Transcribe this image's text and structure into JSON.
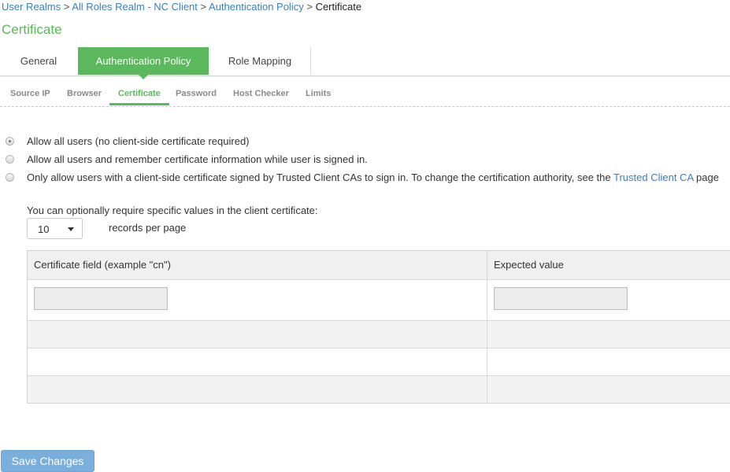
{
  "breadcrumb": {
    "items": [
      "User Realms",
      "All Roles Realm - NC Client",
      "Authentication Policy"
    ],
    "separator": ">",
    "current": "Certificate"
  },
  "page_title": "Certificate",
  "tabs": [
    {
      "label": "General",
      "active": false
    },
    {
      "label": "Authentication Policy",
      "active": true
    },
    {
      "label": "Role Mapping",
      "active": false
    }
  ],
  "subtabs": [
    {
      "label": "Source IP",
      "active": false
    },
    {
      "label": "Browser",
      "active": false
    },
    {
      "label": "Certificate",
      "active": true
    },
    {
      "label": "Password",
      "active": false
    },
    {
      "label": "Host Checker",
      "active": false
    },
    {
      "label": "Limits",
      "active": false
    }
  ],
  "options": [
    {
      "label": "Allow all users (no client-side certificate required)",
      "checked": true
    },
    {
      "label": "Allow all users and remember certificate information while user is signed in.",
      "checked": false
    },
    {
      "label": "Only allow users with a client-side certificate signed by Trusted Client CAs to sign in. To change the certification authority, see the",
      "link": "Trusted Client CA",
      "suffix": "page",
      "checked": false
    }
  ],
  "optional_text": "You can optionally require specific values in the client certificate:",
  "records": {
    "value": "10",
    "label": "records per page"
  },
  "table": {
    "headers": [
      "Certificate field (example \"cn\")",
      "Expected value"
    ],
    "field_value": "",
    "expected_value": ""
  },
  "save_button": "Save Changes",
  "colors": {
    "accent_green": "#5cb85c",
    "link_blue": "#3a7fc1",
    "button_blue": "#79aedd"
  }
}
